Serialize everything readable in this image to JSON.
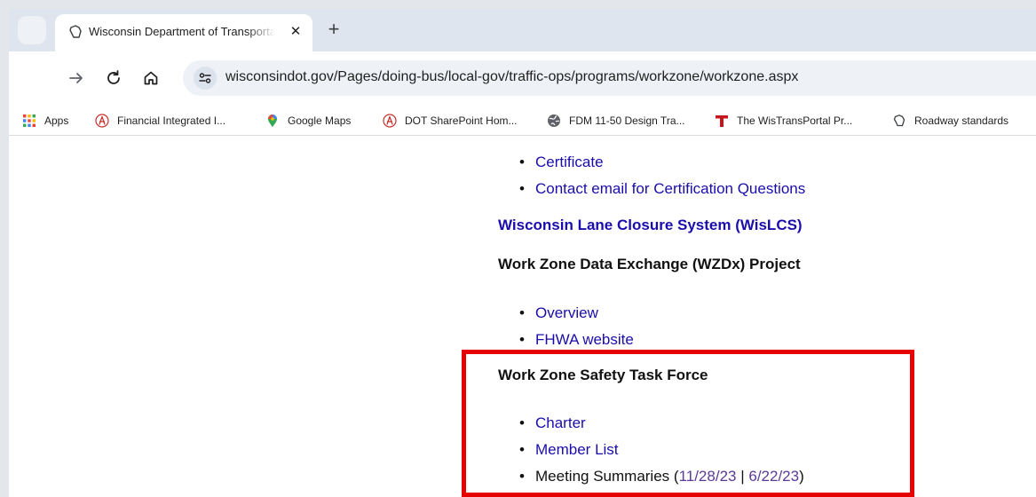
{
  "browser": {
    "tab": {
      "title": "Wisconsin Department of Transportation",
      "close_glyph": "✕"
    },
    "new_tab_glyph": "+",
    "url": "wisconsindot.gov/Pages/doing-bus/local-gov/traffic-ops/programs/workzone/workzone.aspx",
    "bookmarks": [
      {
        "label": "Apps",
        "icon": "apps-grid-icon"
      },
      {
        "label": "Financial Integrated I...",
        "icon": "acrobat-icon"
      },
      {
        "label": "Google Maps",
        "icon": "maps-pin-icon"
      },
      {
        "label": "DOT SharePoint Hom...",
        "icon": "acrobat-icon"
      },
      {
        "label": "FDM 11-50 Design Tra...",
        "icon": "globe-icon"
      },
      {
        "label": "The WisTransPortal Pr...",
        "icon": "t-logo-icon"
      },
      {
        "label": "Roadway standards",
        "icon": "wisconsin-state-icon"
      }
    ]
  },
  "page": {
    "cert_links": [
      "Certificate",
      "Contact email for Certification Questions"
    ],
    "wislcs_heading": "Wisconsin Lane Closure System (WisLCS)",
    "wzdx_heading": "Work Zone Data Exchange (WZDx) Project",
    "wzdx_links": [
      "Overview",
      "FHWA website"
    ],
    "taskforce_heading": "Work Zone Safety Task Force",
    "taskforce_links": [
      "Charter",
      "Member List"
    ],
    "meeting": {
      "label": "Meeting Summaries",
      "open": " (",
      "date1": "11/28/23",
      "sep": " | ",
      "date2": "6/22/23",
      "close": ")"
    }
  },
  "colors": {
    "link": "#1a0dab",
    "visited_link": "#5a3a99",
    "highlight_box": "#e60000"
  }
}
